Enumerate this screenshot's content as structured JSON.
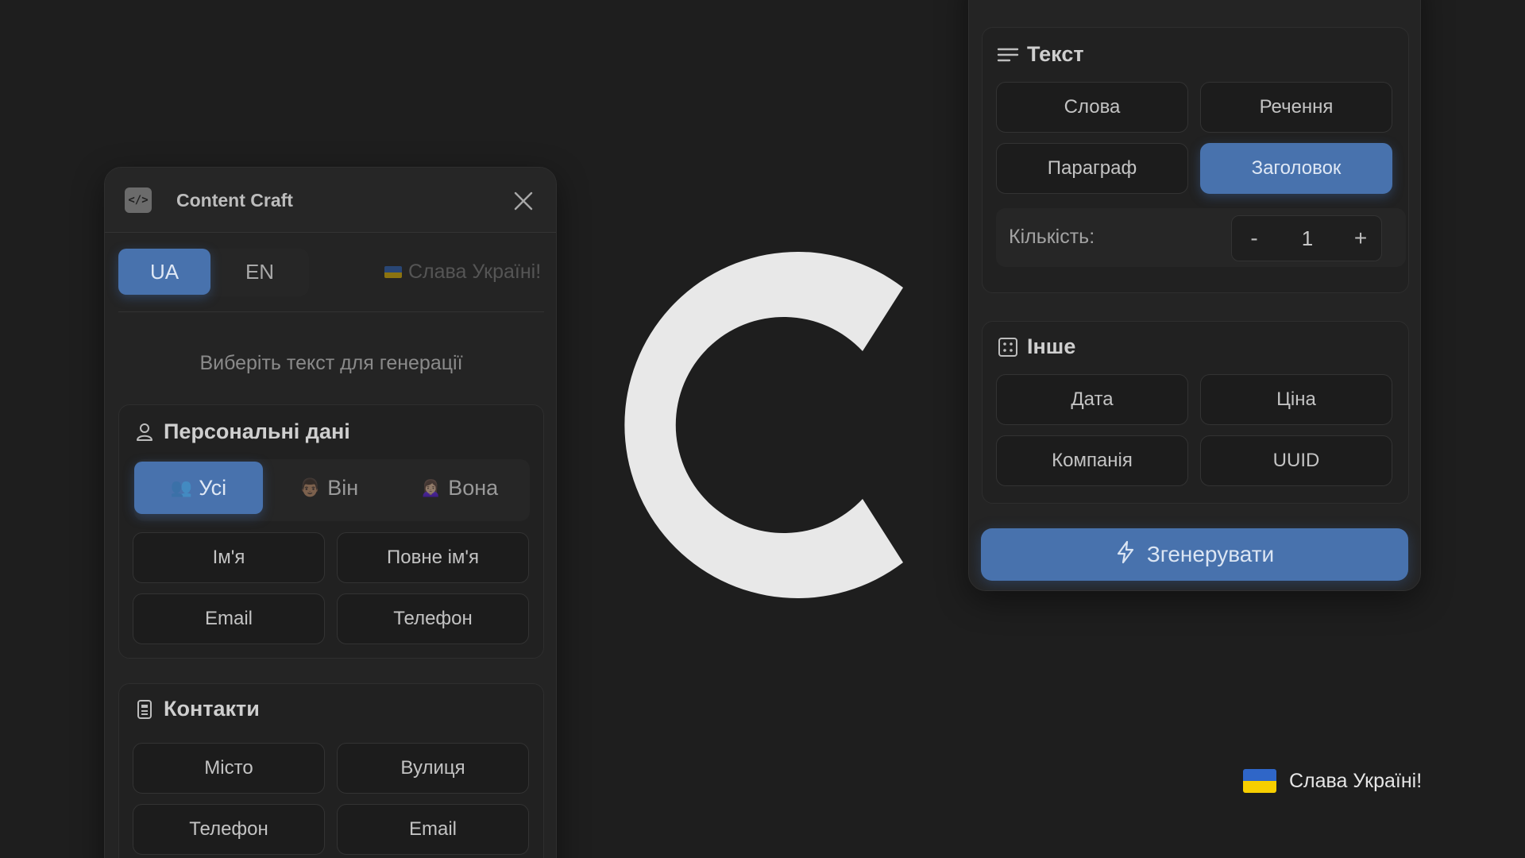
{
  "left_panel": {
    "app_title": "Content Craft",
    "logo_glyph": "</>",
    "languages": [
      {
        "label": "UA",
        "active": true
      },
      {
        "label": "EN",
        "active": false
      }
    ],
    "glory_text": "Слава Україні!",
    "hint": "Виберіть текст для генерації",
    "personal": {
      "title": "Персональні дані",
      "genders": [
        {
          "emoji": "👥",
          "label": "Усі",
          "active": true
        },
        {
          "emoji": "👨🏾",
          "label": "Він",
          "active": false
        },
        {
          "emoji": "🙍🏽‍♀️",
          "label": "Вона",
          "active": false
        }
      ],
      "buttons": [
        "Ім'я",
        "Повне ім'я",
        "Email",
        "Телефон"
      ]
    },
    "contacts": {
      "title": "Контакти",
      "buttons": [
        "Місто",
        "Вулиця",
        "Телефон",
        "Email"
      ]
    }
  },
  "right_panel": {
    "text_section": {
      "title": "Текст",
      "buttons": [
        {
          "label": "Слова",
          "active": false
        },
        {
          "label": "Речення",
          "active": false
        },
        {
          "label": "Параграф",
          "active": false
        },
        {
          "label": "Заголовок",
          "active": true
        }
      ],
      "count_label": "Кількість:",
      "minus": "-",
      "value": "1",
      "plus": "+"
    },
    "other_section": {
      "title": "Інше",
      "buttons": [
        "Дата",
        "Ціна",
        "Компанія",
        "UUID"
      ]
    },
    "generate_label": "Згенерувати"
  },
  "badge": {
    "text": "Слава Україні!"
  },
  "colors": {
    "background": "#1e1e1e",
    "accent": "#4872ad",
    "logo": "#e8e8e8",
    "flag_blue": "#2f66c8",
    "flag_yellow": "#f7cf00"
  }
}
